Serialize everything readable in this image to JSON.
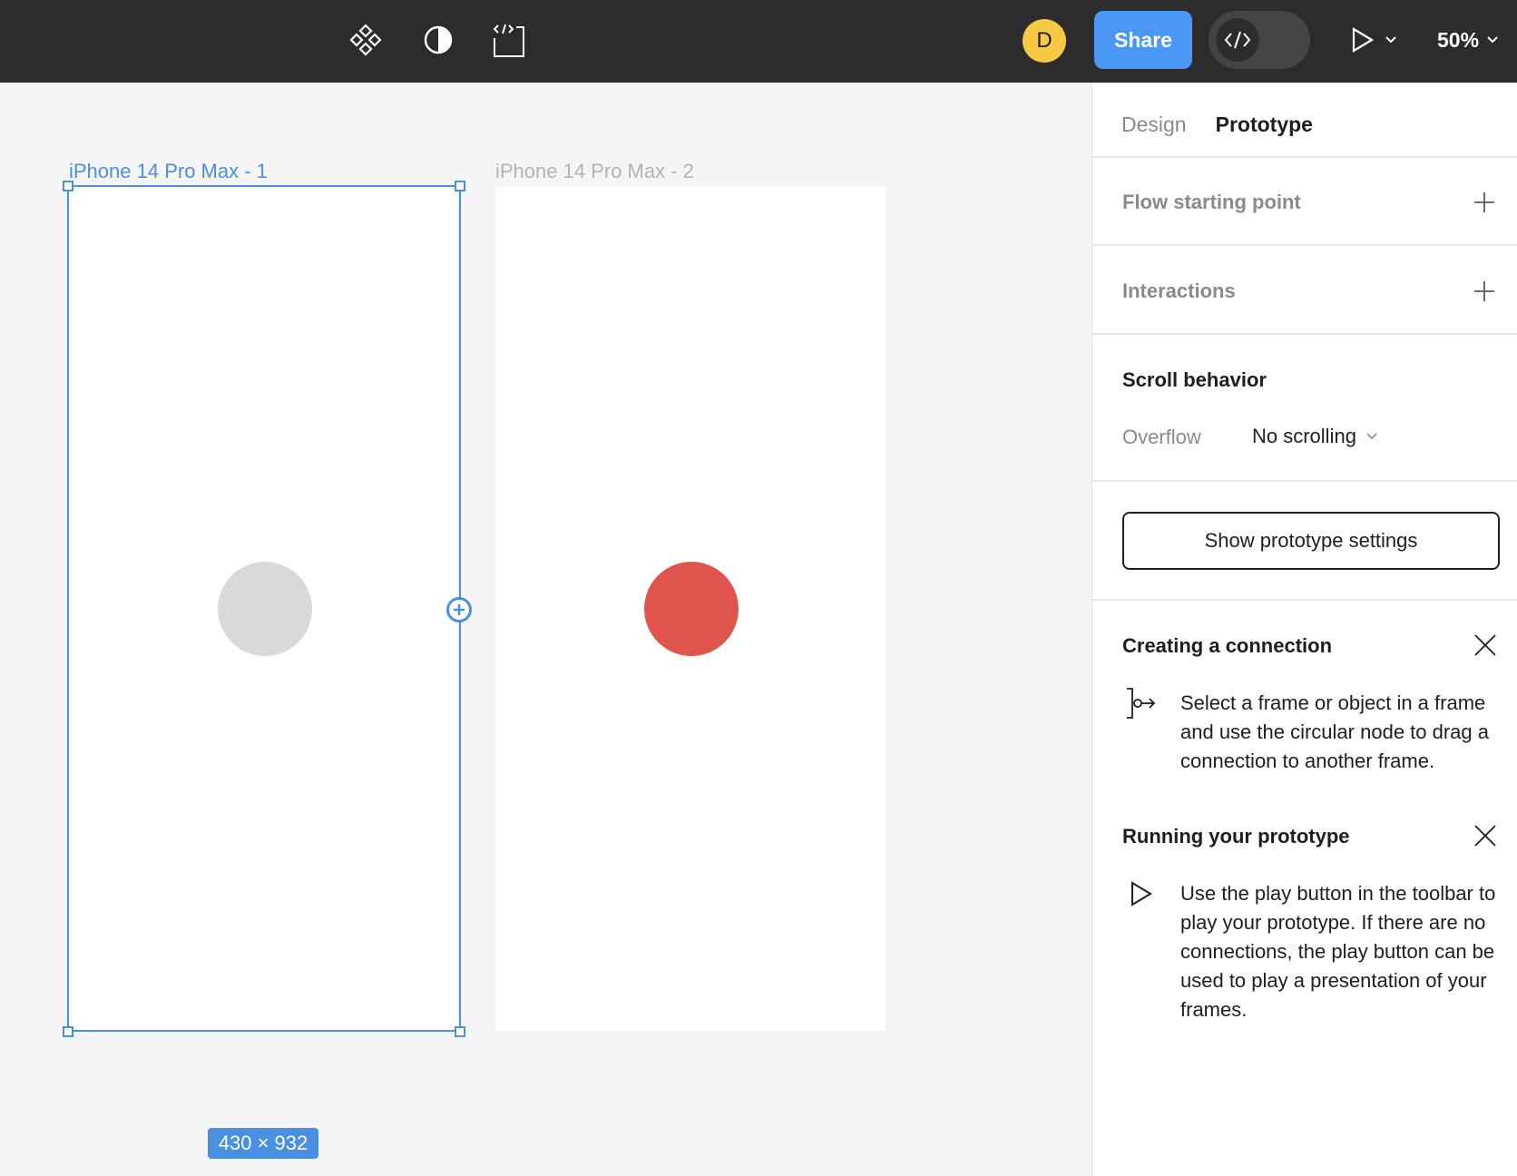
{
  "toolbar": {
    "icons": [
      "components-icon",
      "contrast-icon",
      "dev-frame-icon"
    ],
    "avatar_initial": "D",
    "share_label": "Share",
    "zoom_label": "50%",
    "colors": {
      "bar": "#2c2c2c",
      "share": "#4b97f5",
      "avatar": "#f7c945"
    }
  },
  "canvas": {
    "frames": [
      {
        "label": "iPhone 14 Pro Max - 1",
        "selected": true,
        "circle_color": "#d9d9d9"
      },
      {
        "label": "iPhone 14 Pro Max - 2",
        "selected": false,
        "circle_color": "#e0564e"
      }
    ],
    "size_badge": "430 × 932"
  },
  "panel": {
    "tabs": [
      {
        "label": "Design",
        "active": false
      },
      {
        "label": "Prototype",
        "active": true
      }
    ],
    "flow_starting_point": "Flow starting point",
    "interactions": "Interactions",
    "scroll_behavior": "Scroll behavior",
    "overflow_label": "Overflow",
    "overflow_value": "No scrolling",
    "show_settings_label": "Show prototype settings",
    "hints": [
      {
        "title": "Creating a connection",
        "icon": "connection-icon",
        "text": "Select a frame or object in a frame and use the circular node to drag a connection to another frame."
      },
      {
        "title": "Running your prototype",
        "icon": "play-icon",
        "text": "Use the play button in the toolbar to play your prototype. If there are no connections, the play button can be used to play a presentation of your frames."
      }
    ]
  }
}
